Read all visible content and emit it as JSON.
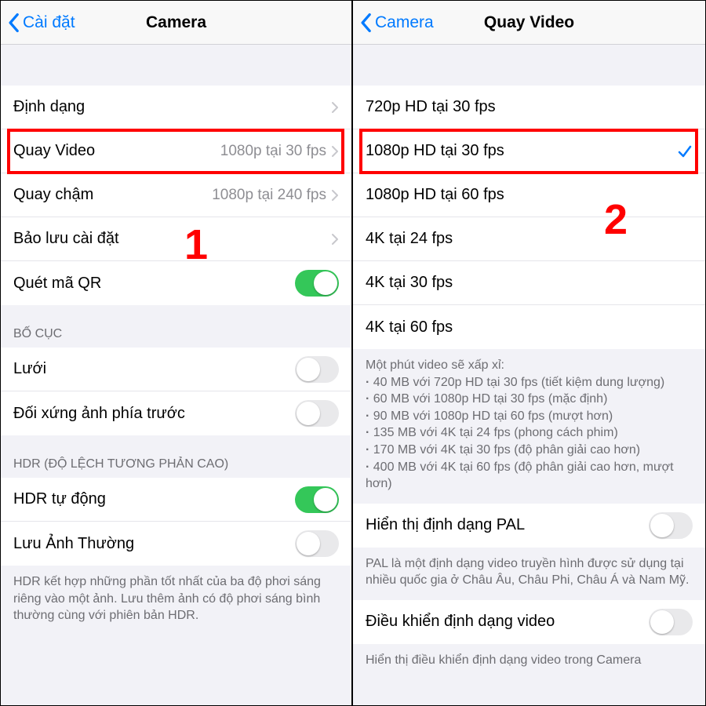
{
  "left": {
    "nav": {
      "back": "Cài đặt",
      "title": "Camera"
    },
    "rows": {
      "format": "Định dạng",
      "record_video": {
        "label": "Quay Video",
        "value": "1080p tại 30 fps"
      },
      "slomo": {
        "label": "Quay chậm",
        "value": "1080p tại 240 fps"
      },
      "preserve": "Bảo lưu cài đặt",
      "qr": "Quét mã QR"
    },
    "section_layout": "BỐ CỤC",
    "grid": "Lưới",
    "mirror": "Đối xứng ảnh phía trước",
    "section_hdr": "HDR (ĐỘ LỆCH TƯƠNG PHẢN CAO)",
    "hdr_auto": "HDR tự động",
    "keep_normal": "Lưu Ảnh Thường",
    "hdr_footer": "HDR kết hợp những phần tốt nhất của ba độ phơi sáng riêng vào một ảnh. Lưu thêm ảnh có độ phơi sáng bình thường cùng với phiên bản HDR.",
    "step": "1"
  },
  "right": {
    "nav": {
      "back": "Camera",
      "title": "Quay Video"
    },
    "options": [
      "720p HD tại 30 fps",
      "1080p HD tại 30 fps",
      "1080p HD tại 60 fps",
      "4K tại 24 fps",
      "4K tại 30 fps",
      "4K tại 60 fps"
    ],
    "footer_lead": "Một phút video sẽ xấp xỉ:",
    "footer_items": [
      "40 MB với 720p HD tại 30 fps (tiết kiệm dung lượng)",
      "60 MB với 1080p HD tại 30 fps (mặc định)",
      "90 MB với 1080p HD tại 60 fps (mượt hơn)",
      "135 MB với 4K tại 24 fps (phong cách phim)",
      "170 MB với 4K tại 30 fps (độ phân giải cao hơn)",
      "400 MB với 4K tại 60 fps (độ phân giải cao hơn, mượt hơn)"
    ],
    "pal": "Hiển thị định dạng PAL",
    "pal_footer": "PAL là một định dạng video truyền hình được sử dụng tại nhiều quốc gia ở Châu Âu, Châu Phi, Châu Á và Nam Mỹ.",
    "video_ctrl": "Điều khiển định dạng video",
    "video_ctrl_footer": "Hiển thị điều khiển định dạng video trong Camera",
    "step": "2"
  }
}
